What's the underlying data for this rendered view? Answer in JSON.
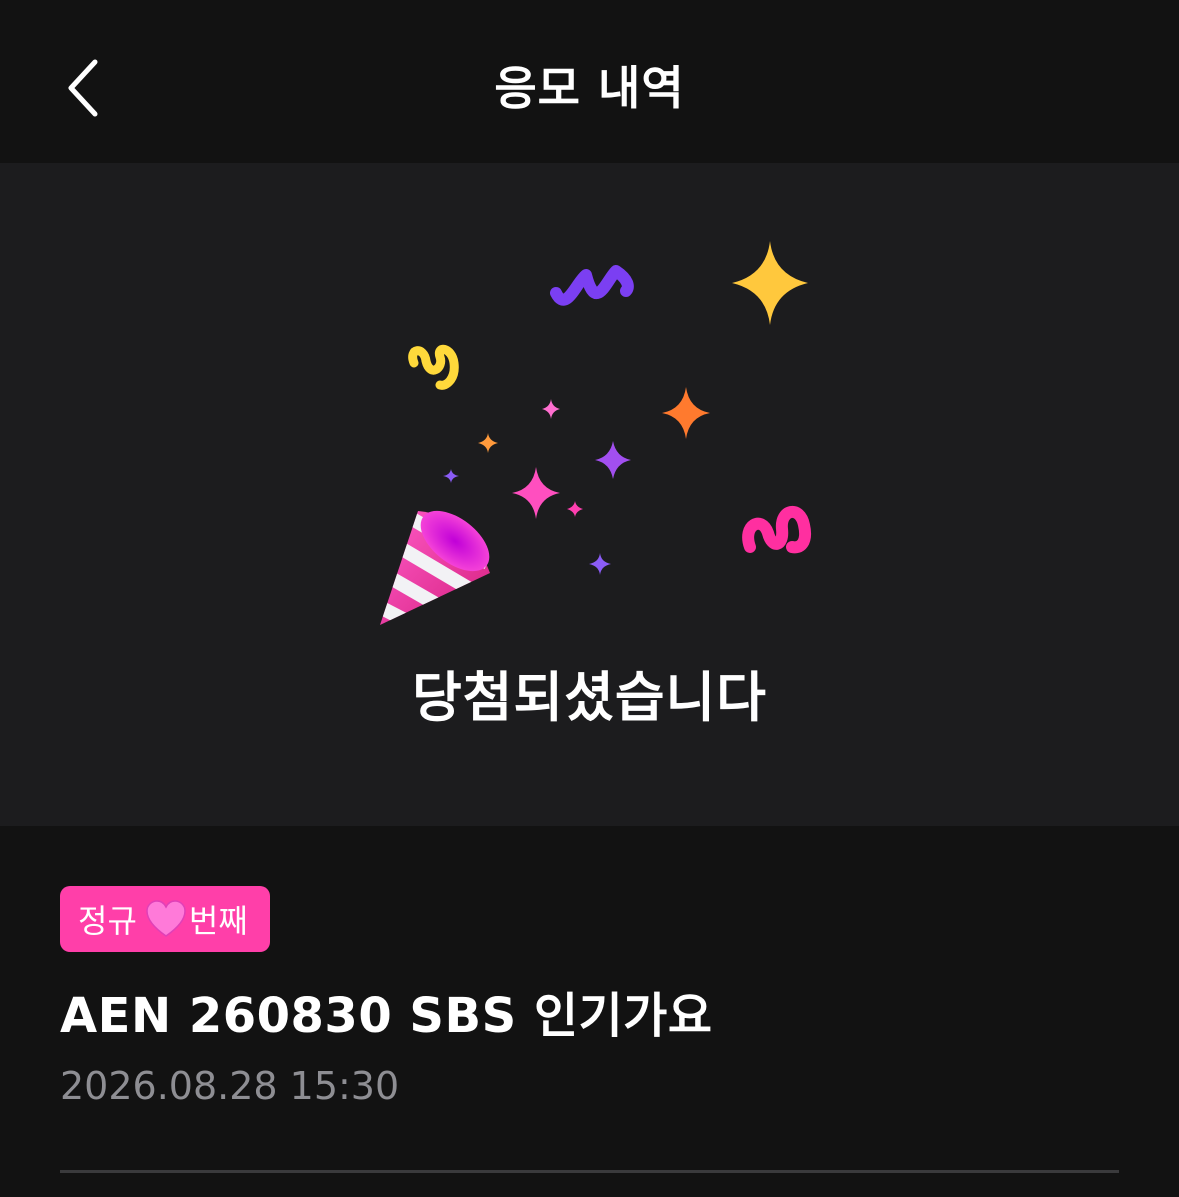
{
  "header": {
    "title": "응모 내역",
    "back_icon": "chevron-left-icon"
  },
  "result": {
    "message": "당첨되셨습니다",
    "illustration": "party-popper-confetti"
  },
  "entry": {
    "badge": {
      "prefix": "정규",
      "suffix": "번째",
      "icon": "heart-icon",
      "color": "#ff3fa9"
    },
    "title": "AEN 260830 SBS 인기가요",
    "datetime": "2026.08.28 15:30"
  },
  "colors": {
    "background": "#121212",
    "hero_background": "#1c1c1e",
    "accent": "#ff3fa9",
    "secondary_text": "#8e8e93"
  }
}
